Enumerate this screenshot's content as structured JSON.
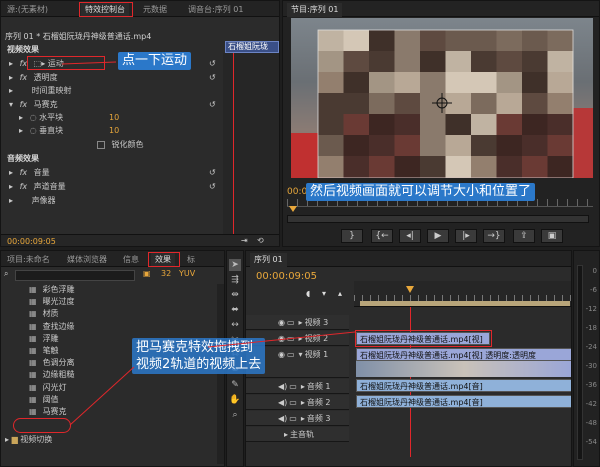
{
  "effect_controls": {
    "tabs": [
      "源:(无素材)",
      "特效控制台",
      "元数据",
      "调音台:序列 01"
    ],
    "sequence_clip": "序列 01 * 石榴姐阮珑丹神级普通话.mp4",
    "clip_chip": "石榴姐阮珑",
    "video_effects_header": "视频效果",
    "items": [
      {
        "label": "运动",
        "kind": "video"
      },
      {
        "label": "透明度",
        "kind": "video"
      },
      {
        "label": "时间重映射",
        "kind": "video"
      },
      {
        "label": "马赛克",
        "kind": "video"
      }
    ],
    "params": [
      {
        "label": "水平块",
        "value": "10"
      },
      {
        "label": "垂直块",
        "value": "10"
      }
    ],
    "sharpen_label": "锐化颜色",
    "audio_effects_header": "音频效果",
    "audio_items": [
      "音量",
      "声道音量",
      "声像器"
    ],
    "timecode": "00:00:09:05"
  },
  "program": {
    "tab": "节目:序列 01",
    "timecode": "00:00:09:",
    "annotation": "然后视频画面就可以调节大小和位置了"
  },
  "callouts": {
    "motion": "点一下运动",
    "drag": "把马赛克特效拖拽到\n视频2轨道的视频上去"
  },
  "project": {
    "tabs": [
      "项目:未命名",
      "媒体浏览器",
      "信息",
      "效果",
      "标"
    ],
    "effects_list": [
      "彩色浮雕",
      "曝光过度",
      "材质",
      "查找边缘",
      "浮雕",
      "笔触",
      "色调分离",
      "边缘粗糙",
      "闪光灯",
      "阈值",
      "马赛克"
    ],
    "folder_label": "视频切换"
  },
  "timeline": {
    "tab": "序列 01",
    "timecode": "00:00:09:05",
    "tracks": [
      {
        "name": "视频 3",
        "type": "video"
      },
      {
        "name": "视频 2",
        "type": "video"
      },
      {
        "name": "视频 1",
        "type": "video"
      },
      {
        "name": "音频 1",
        "type": "audio"
      },
      {
        "name": "音频 2",
        "type": "audio"
      },
      {
        "name": "音频 3",
        "type": "audio"
      },
      {
        "name": "主音轨",
        "type": "master"
      }
    ],
    "clips": {
      "v2": "石榴姐阮珑丹神级普通话.mp4[视]",
      "v1": "石榴姐阮珑丹神级普通话.mp4[视] 透明度:透明度",
      "a1": "石榴姐阮珑丹神级普通话.mp4[音]",
      "a2": "石榴姐阮珑丹神级普通话.mp4[音]"
    },
    "meter_labels": [
      "0",
      "-6",
      "-12",
      "-18",
      "-24",
      "-30",
      "-36",
      "-42",
      "-48",
      "-54"
    ]
  },
  "colors": {
    "accent": "#e8a73b",
    "callout": "#2b78c9",
    "highlight": "#e0272b",
    "clip_video": "#9aa6d8",
    "clip_audio": "#8fb1d9"
  }
}
